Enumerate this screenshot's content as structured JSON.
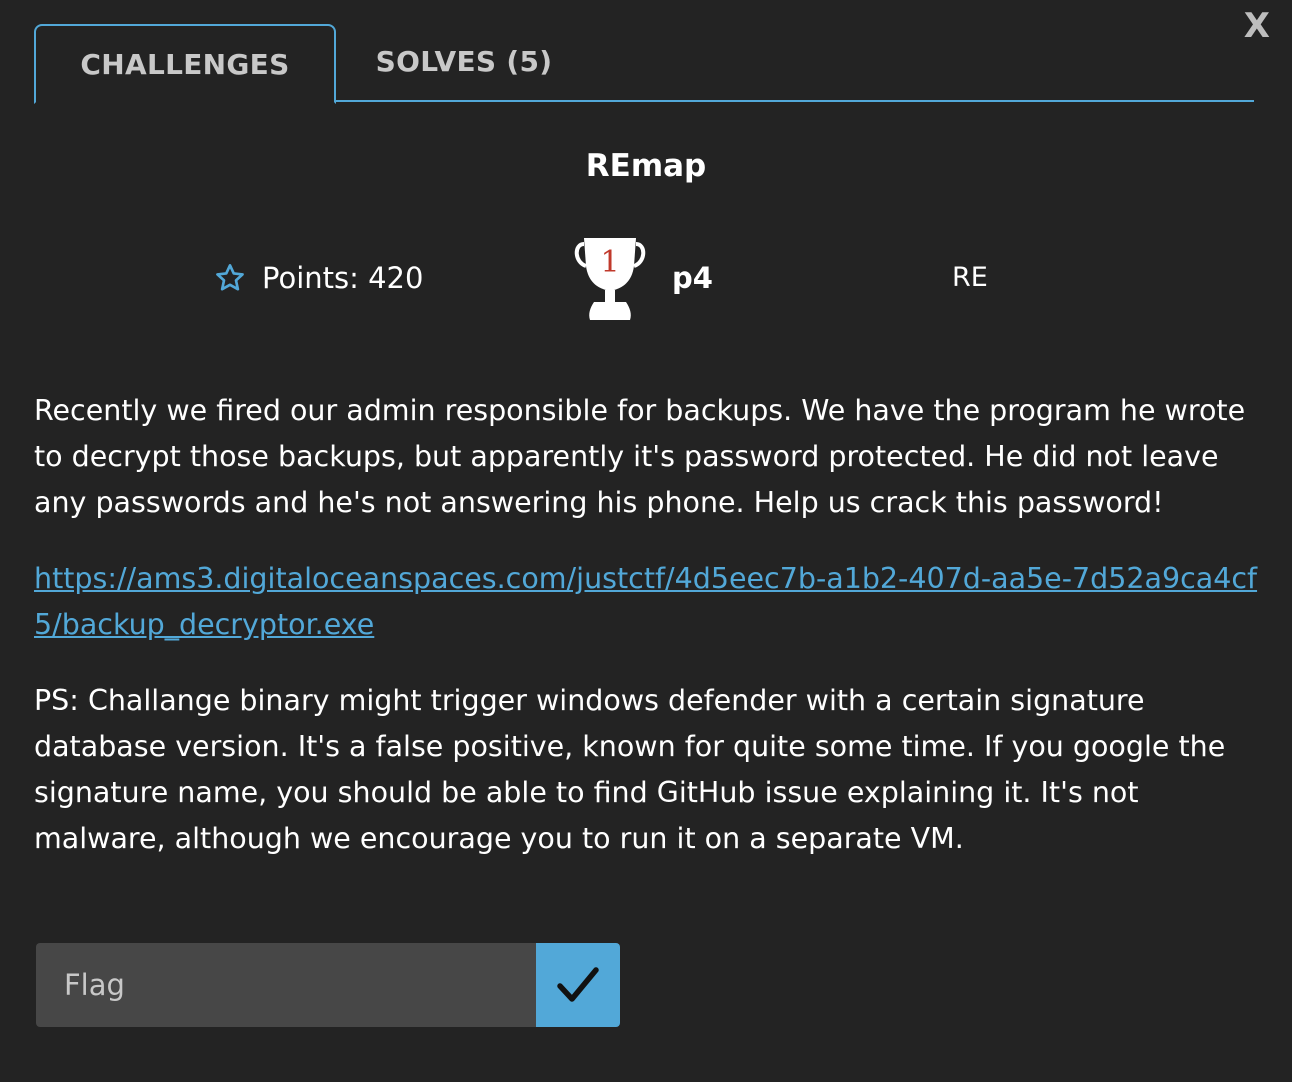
{
  "window": {
    "close_label": "X"
  },
  "tabs": [
    {
      "label": "CHALLENGES",
      "active": true
    },
    {
      "label": "SOLVES (5)",
      "active": false
    }
  ],
  "challenge": {
    "title": "REmap",
    "points_label": "Points: 420",
    "first_blood_rank": "1",
    "first_blood_team": "p4",
    "category": "RE",
    "description_1": "Recently we fired our admin responsible for backups. We have the program he wrote to decrypt those backups, but apparently it's password protected. He did not leave any passwords and he's not answering his phone. Help us crack this password!",
    "link": "https://ams3.digitaloceanspaces.com/justctf/4d5eec7b-a1b2-407d-aa5e-7d52a9ca4cf5/backup_decryptor.exe",
    "description_2": "PS: Challange binary might trigger windows defender with a certain signature database version. It's a false positive, known for quite some time. If you google the signature name, you should be able to find GitHub issue explaining it. It's not malware, although we encourage you to run it on a separate VM."
  },
  "flag_form": {
    "placeholder": "Flag",
    "value": ""
  },
  "colors": {
    "background": "#232323",
    "accent": "#52a8d8",
    "input_bg": "#474747",
    "trophy_number": "#c0392b"
  },
  "icons": {
    "points": "star-outline-icon",
    "first_blood": "trophy-icon",
    "submit": "checkmark-icon"
  }
}
